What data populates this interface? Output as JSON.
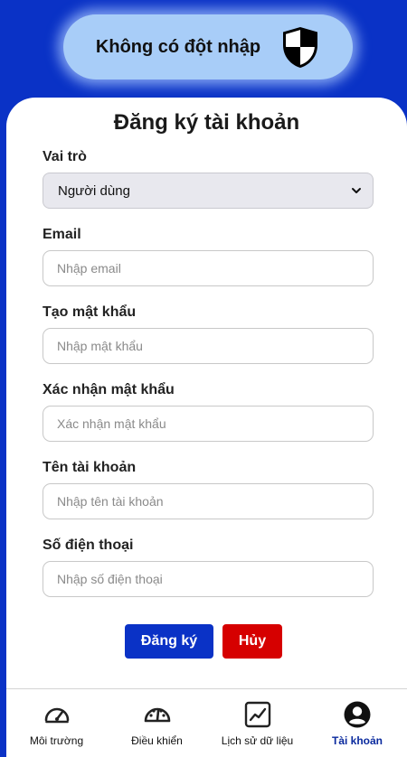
{
  "status": {
    "text": "Không có đột nhập",
    "icon": "shield-icon"
  },
  "form": {
    "title": "Đăng ký tài khoản",
    "role": {
      "label": "Vai trò",
      "value": "Người dùng"
    },
    "email": {
      "label": "Email",
      "placeholder": "Nhập email",
      "value": ""
    },
    "password": {
      "label": "Tạo mật khẩu",
      "placeholder": "Nhập mật khẩu",
      "value": ""
    },
    "confirm_password": {
      "label": "Xác nhận mật khẩu",
      "placeholder": "Xác nhận mật khẩu",
      "value": ""
    },
    "username": {
      "label": "Tên tài khoản",
      "placeholder": "Nhập tên tài khoản",
      "value": ""
    },
    "phone": {
      "label": "Số điện thoại",
      "placeholder": "Nhập số điện thoại",
      "value": ""
    },
    "register_label": "Đăng ký",
    "cancel_label": "Hủy"
  },
  "nav": {
    "items": [
      {
        "label": "Môi trường",
        "icon": "gauge-icon",
        "active": false
      },
      {
        "label": "Điều khiển",
        "icon": "speedometer-icon",
        "active": false
      },
      {
        "label": "Lịch sử dữ liệu",
        "icon": "line-chart-icon",
        "active": false
      },
      {
        "label": "Tài khoản",
        "icon": "account-icon",
        "active": true
      }
    ]
  },
  "colors": {
    "primary": "#0a32c6",
    "danger": "#d60000",
    "status_pill": "#a8cdf8",
    "active_nav": "#0a2a9e"
  }
}
